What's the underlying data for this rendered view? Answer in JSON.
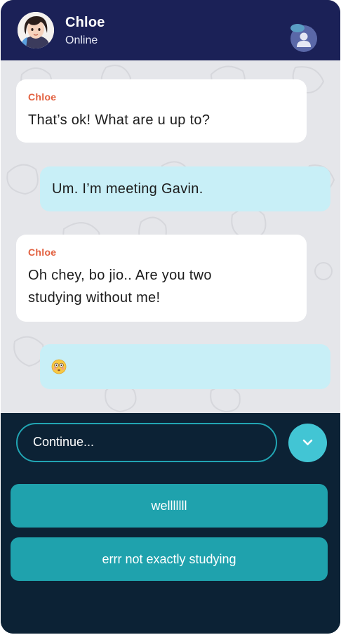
{
  "header": {
    "name": "Chloe",
    "status": "Online"
  },
  "messages": [
    {
      "direction": "in",
      "sender": "Chloe",
      "text": "That’s ok! What are u up to?"
    },
    {
      "direction": "out",
      "text": "Um. I’m meeting Gavin."
    },
    {
      "direction": "in",
      "sender": "Chloe",
      "text_lines": [
        "Oh chey, bo jio.. Are you two",
        "studying without me!"
      ]
    },
    {
      "direction": "out",
      "emoji": "flushed-face-emoji"
    }
  ],
  "composer": {
    "placeholder": "Continue...",
    "expand_icon": "chevron-down-icon"
  },
  "replies": [
    {
      "label": "welllllll"
    },
    {
      "label": "errr not exactly studying"
    }
  ],
  "colors": {
    "header_bg": "#1b2157",
    "chat_bg": "#e5e6ea",
    "incoming_bubble": "#ffffff",
    "outgoing_bubble": "#c8eff7",
    "sender_name": "#e2603f",
    "panel_bg": "#0c2235",
    "accent": "#1fa2ad"
  }
}
